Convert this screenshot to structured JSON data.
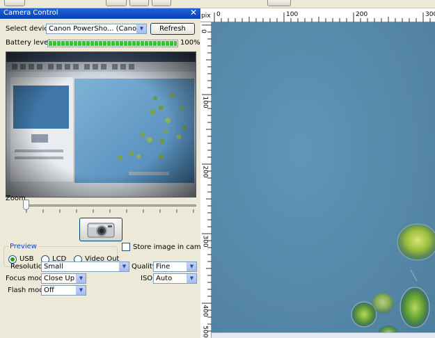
{
  "panel": {
    "title": "Camera Control",
    "close_glyph": "✕",
    "select_device_label": "Select device",
    "device_value": "Canon PowerSho... (Canon PS)",
    "refresh_label": "Refresh",
    "battery_label": "Battery level",
    "battery_percent_text": "100%",
    "battery_fraction": 1.0,
    "zoom_label": "Zoom",
    "zoom_fraction": 0.0,
    "shutter_icon": "camera-icon",
    "preview_group_label": "Preview",
    "radio_options": [
      "USB",
      "LCD",
      "Video Out"
    ],
    "radio_selected": "USB",
    "store_image_label": "Store image in camera",
    "store_image_checked": false,
    "resolution_label": "Resolution",
    "resolution_value": "Small",
    "quality_label": "Quality",
    "quality_value": "Fine",
    "focus_mode_label": "Focus mode",
    "focus_mode_value": "Close Up",
    "iso_label": "ISO",
    "iso_value": "Auto",
    "flash_mode_label": "Flash mode",
    "flash_mode_value": "Off"
  },
  "ruler": {
    "unit_label": "pix",
    "h_labels": [
      "0",
      "100",
      "200",
      "300"
    ],
    "v_labels": [
      "0",
      "100",
      "200",
      "300",
      "400",
      "500"
    ]
  },
  "colors": {
    "title_bar": "#0a3fb8",
    "canvas_background": "#5988aa",
    "battery_green": "#37c337"
  }
}
